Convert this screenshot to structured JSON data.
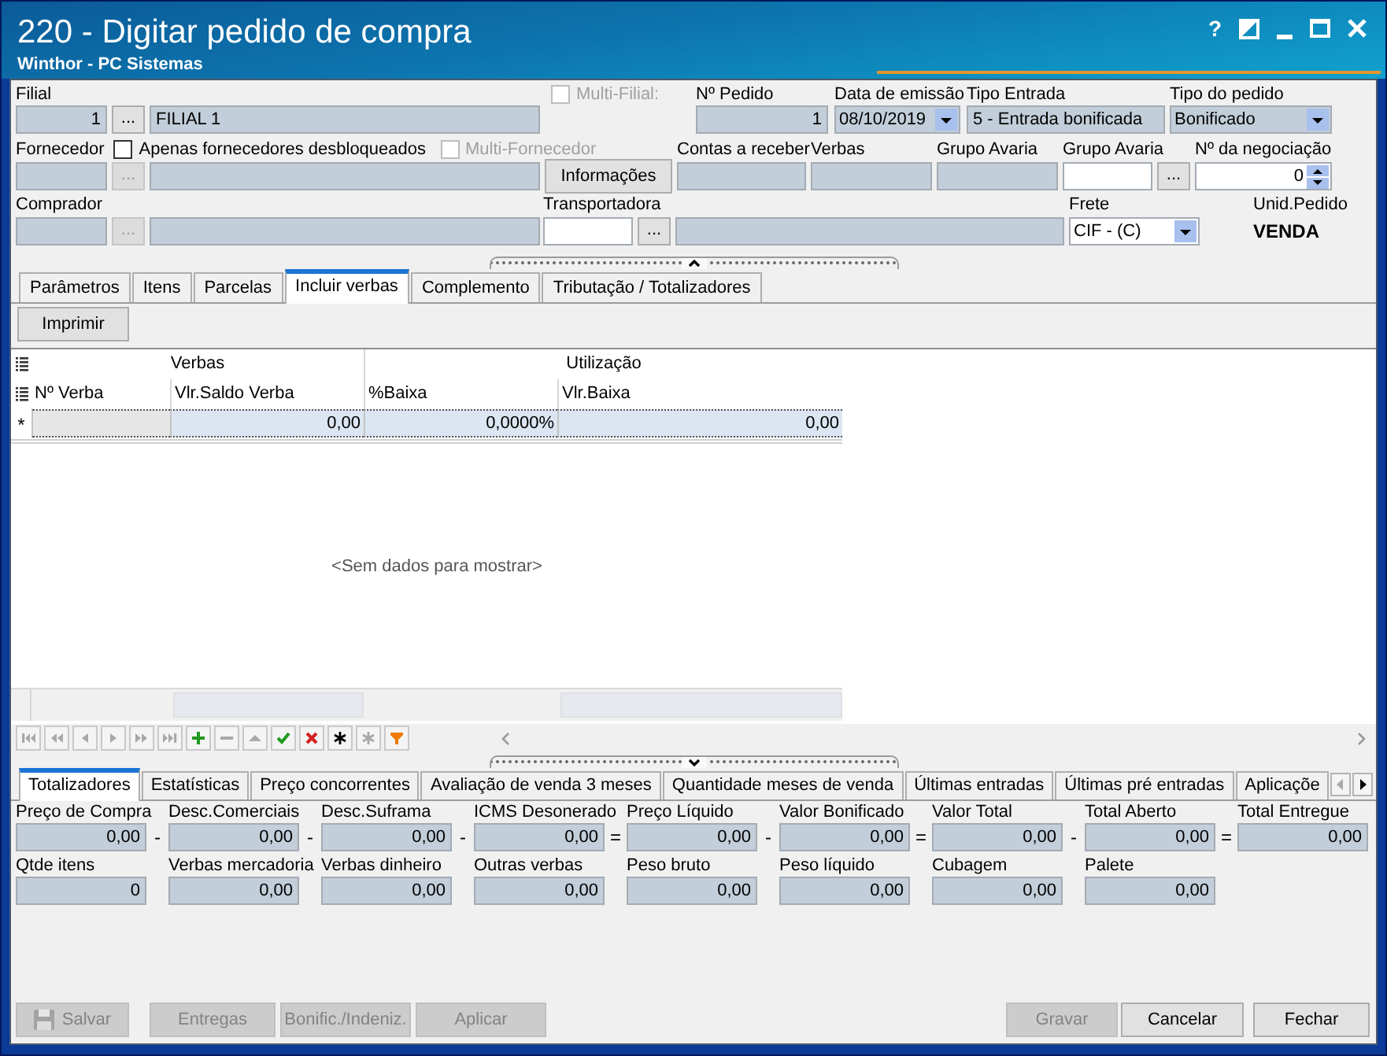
{
  "window": {
    "title": "220 - Digitar pedido de compra",
    "subtitle": "Winthor - PC Sistemas"
  },
  "title_buttons": [
    {
      "kind": "help",
      "label": "?"
    },
    {
      "kind": "restore"
    },
    {
      "kind": "minimize"
    },
    {
      "kind": "maximize"
    },
    {
      "kind": "close"
    }
  ],
  "header": {
    "filial": {
      "label": "Filial",
      "code": "1",
      "lookup": "...",
      "lookup_disabled": false,
      "name": "FILIAL 1",
      "read_only": true
    },
    "multi_filial": {
      "label": "Multi-Filial:",
      "checked": false,
      "disabled": true
    },
    "numero_pedido": {
      "label": "Nº Pedido",
      "value": "1",
      "read_only": true
    },
    "data_emissao": {
      "label": "Data de emissão",
      "value": "08/10/2019",
      "read_only": true
    },
    "tipo_entrada": {
      "label": "Tipo Entrada",
      "value": "5 - Entrada bonificada",
      "read_only": true
    },
    "tipo_pedido": {
      "label": "Tipo do pedido",
      "value": "Bonificado",
      "read_only": true
    },
    "fornecedor": {
      "label": "Fornecedor",
      "lookup": "...",
      "lookup_disabled": true,
      "read_only": true
    },
    "apenas_desbloqueados": {
      "label": "Apenas fornecedores desbloqueados",
      "checked": false,
      "disabled": false
    },
    "multi_fornecedor": {
      "label": "Multi-Fornecedor",
      "checked": false,
      "disabled": true
    },
    "informacoes": {
      "label": "Informações"
    },
    "contas_receber": {
      "label": "Contas a receber",
      "read_only": true
    },
    "verbas": {
      "label": "Verbas",
      "read_only": true
    },
    "grupo_avaria": {
      "label": "Grupo Avaria",
      "read_only": true
    },
    "grupo_avaria_busca": {
      "label": "Grupo Avaria",
      "lookup": "...",
      "lookup_disabled": false,
      "read_only": false
    },
    "negociacao": {
      "label": "Nº da negociação",
      "value": "0",
      "read_only": false
    },
    "comprador": {
      "label": "Comprador",
      "lookup": "...",
      "lookup_disabled": true,
      "read_only": true
    },
    "transportadora": {
      "label": "Transportadora",
      "lookup": "...",
      "lookup_disabled": false,
      "code_read_only": false,
      "name_read_only": true
    },
    "frete": {
      "label": "Frete",
      "value": "CIF - (C)",
      "read_only": false
    },
    "unid_pedido": {
      "label": "Unid.Pedido",
      "value": "VENDA"
    }
  },
  "tabs": [
    {
      "label": "Parâmetros",
      "selected": false
    },
    {
      "label": "Itens",
      "selected": false
    },
    {
      "label": "Parcelas",
      "selected": false
    },
    {
      "label": "Incluir verbas",
      "selected": true
    },
    {
      "label": "Complemento",
      "selected": false
    },
    {
      "label": "Tributação / Totalizadores",
      "selected": false
    }
  ],
  "verbas_tab": {
    "print_button": "Imprimir",
    "grid": {
      "bands": [
        {
          "label": "Verbas",
          "columns": [
            {
              "label": "Nº Verba",
              "summary": false
            },
            {
              "label": "Vlr.Saldo Verba",
              "summary": true
            }
          ]
        },
        {
          "label": "Utilização",
          "columns": [
            {
              "label": "%Baixa",
              "summary": false
            },
            {
              "label": "Vlr.Baixa",
              "summary": true
            }
          ]
        }
      ],
      "new_row": {
        "indicator": "*",
        "cells": [
          {
            "focused": true
          },
          {
            "value": "0,00",
            "focused": false
          },
          {
            "value": "0,0000%",
            "focused": false
          },
          {
            "value": "0,00",
            "focused": false
          }
        ]
      },
      "empty_text": "<Sem dados para mostrar>"
    },
    "navigator": [
      {
        "kind": "first",
        "disabled": true
      },
      {
        "kind": "prior_page",
        "disabled": true
      },
      {
        "kind": "prior",
        "disabled": true
      },
      {
        "kind": "next",
        "disabled": true
      },
      {
        "kind": "next_page",
        "disabled": true
      },
      {
        "kind": "last",
        "disabled": true
      },
      {
        "kind": "insert",
        "disabled": false
      },
      {
        "kind": "delete",
        "disabled": true
      },
      {
        "kind": "edit",
        "disabled": true
      },
      {
        "kind": "post",
        "disabled": false
      },
      {
        "kind": "cancel",
        "disabled": false
      },
      {
        "kind": "asterisk",
        "disabled": false
      },
      {
        "kind": "asterisk",
        "disabled": true
      },
      {
        "kind": "filter",
        "disabled": false
      }
    ]
  },
  "bottom_tabs": [
    {
      "label": "Totalizadores",
      "selected": true
    },
    {
      "label": "Estatísticas",
      "selected": false
    },
    {
      "label": "Preço concorrentes",
      "selected": false
    },
    {
      "label": "Avaliação de venda 3 meses",
      "selected": false
    },
    {
      "label": "Quantidade meses de venda",
      "selected": false
    },
    {
      "label": "Últimas entradas",
      "selected": false
    },
    {
      "label": "Últimas pré entradas",
      "selected": false
    },
    {
      "label": "Aplicaçõe",
      "selected": false
    }
  ],
  "tab_scroll": [
    {
      "kind": "left",
      "disabled": true
    },
    {
      "kind": "right",
      "disabled": false
    }
  ],
  "totalizadores": {
    "row_1": [
      {
        "label": "Preço de Compra",
        "value": "0,00",
        "operator": "-"
      },
      {
        "label": "Desc.Comerciais",
        "value": "0,00",
        "operator": "-"
      },
      {
        "label": "Desc.Suframa",
        "value": "0,00",
        "operator": "-"
      },
      {
        "label": "ICMS Desonerado",
        "value": "0,00",
        "operator": "="
      },
      {
        "label": "Preço Líquido",
        "value": "0,00",
        "operator": "-"
      },
      {
        "label": "Valor Bonificado",
        "value": "0,00",
        "operator": "="
      },
      {
        "label": "Valor Total",
        "value": "0,00",
        "operator": "-"
      },
      {
        "label": "Total Aberto",
        "value": "0,00",
        "operator": "="
      },
      {
        "label": "Total Entregue",
        "value": "0,00"
      }
    ],
    "row_2": [
      {
        "label": "Qtde itens",
        "value": "0"
      },
      {
        "label": "Verbas mercadoria",
        "value": "0,00"
      },
      {
        "label": "Verbas dinheiro",
        "value": "0,00"
      },
      {
        "label": "Outras verbas",
        "value": "0,00"
      },
      {
        "label": "Peso bruto",
        "value": "0,00"
      },
      {
        "label": "Peso líquido",
        "value": "0,00"
      },
      {
        "label": "Cubagem",
        "value": "0,00"
      },
      {
        "label": "Palete",
        "value": "0,00"
      }
    ]
  },
  "actions": {
    "left": [
      {
        "label": "Salvar",
        "kind": "save",
        "disabled": true
      },
      {
        "label": "Entregas",
        "kind": "text",
        "disabled": true
      },
      {
        "label": "Bonific./Indeniz.",
        "kind": "text",
        "disabled": true
      },
      {
        "label": "Aplicar",
        "kind": "text",
        "disabled": true
      }
    ],
    "right": [
      {
        "label": "Gravar",
        "kind": "text",
        "disabled": true
      },
      {
        "label": "Cancelar",
        "kind": "text",
        "disabled": false
      },
      {
        "label": "Fechar",
        "kind": "text",
        "disabled": false
      }
    ]
  }
}
